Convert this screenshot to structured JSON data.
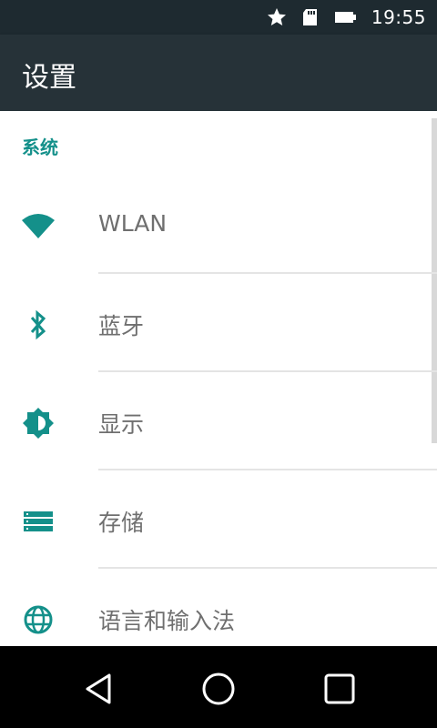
{
  "status_bar": {
    "time": "19:55",
    "icons": [
      "star-icon",
      "sd-card-icon",
      "battery-icon"
    ]
  },
  "app_bar": {
    "title": "设置"
  },
  "settings": {
    "section_title": "系统",
    "items": [
      {
        "label": "WLAN",
        "icon": "wifi-icon"
      },
      {
        "label": "蓝牙",
        "icon": "bluetooth-icon"
      },
      {
        "label": "显示",
        "icon": "brightness-icon"
      },
      {
        "label": "存储",
        "icon": "storage-icon"
      },
      {
        "label": "语言和输入法",
        "icon": "language-icon"
      }
    ]
  },
  "nav_bar": {
    "buttons": [
      "back",
      "home",
      "recents"
    ]
  },
  "colors": {
    "accent": "#14908a",
    "app_bar": "#263238",
    "status_bar": "#1e2a30"
  }
}
